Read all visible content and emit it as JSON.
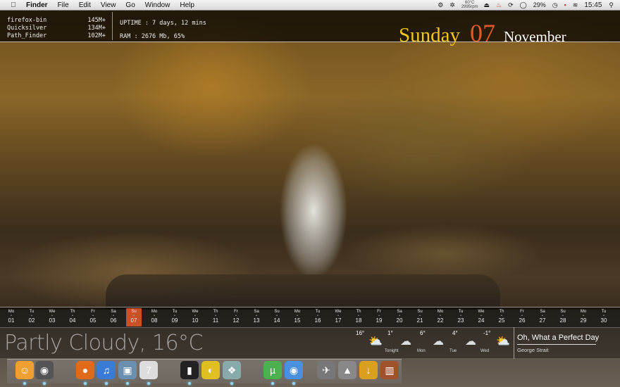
{
  "menubar": {
    "apple_icon": "apple-icon",
    "items": [
      "Finder",
      "File",
      "Edit",
      "View",
      "Go",
      "Window",
      "Help"
    ],
    "tray": {
      "temp": "60°C",
      "fan": "2995rpm",
      "battery": "29%",
      "time": "15:45"
    }
  },
  "processes": [
    {
      "name": "firefox-bin",
      "mem": "145M+"
    },
    {
      "name": "Quicksilver",
      "mem": "134M+"
    },
    {
      "name": "Path_Finder",
      "mem": "102M+"
    }
  ],
  "system": {
    "uptime": "UPTIME : 7 days, 12 mins",
    "ram": "RAM : 2676 Mb, 65%"
  },
  "date": {
    "weekday": "Sunday",
    "day": "07",
    "month": "November"
  },
  "calendar": [
    {
      "wd": "Mo",
      "dn": "01"
    },
    {
      "wd": "Tu",
      "dn": "02"
    },
    {
      "wd": "We",
      "dn": "03"
    },
    {
      "wd": "Th",
      "dn": "04"
    },
    {
      "wd": "Fr",
      "dn": "05"
    },
    {
      "wd": "Sa",
      "dn": "06"
    },
    {
      "wd": "Su",
      "dn": "07"
    },
    {
      "wd": "Mo",
      "dn": "08"
    },
    {
      "wd": "Tu",
      "dn": "09"
    },
    {
      "wd": "We",
      "dn": "10"
    },
    {
      "wd": "Th",
      "dn": "11"
    },
    {
      "wd": "Fr",
      "dn": "12"
    },
    {
      "wd": "Sa",
      "dn": "13"
    },
    {
      "wd": "Su",
      "dn": "14"
    },
    {
      "wd": "Mo",
      "dn": "15"
    },
    {
      "wd": "Tu",
      "dn": "16"
    },
    {
      "wd": "We",
      "dn": "17"
    },
    {
      "wd": "Th",
      "dn": "18"
    },
    {
      "wd": "Fr",
      "dn": "19"
    },
    {
      "wd": "Sa",
      "dn": "20"
    },
    {
      "wd": "Su",
      "dn": "21"
    },
    {
      "wd": "Mo",
      "dn": "22"
    },
    {
      "wd": "Tu",
      "dn": "23"
    },
    {
      "wd": "We",
      "dn": "24"
    },
    {
      "wd": "Th",
      "dn": "25"
    },
    {
      "wd": "Fr",
      "dn": "26"
    },
    {
      "wd": "Sa",
      "dn": "27"
    },
    {
      "wd": "Su",
      "dn": "28"
    },
    {
      "wd": "Mo",
      "dn": "29"
    },
    {
      "wd": "Tu",
      "dn": "30"
    }
  ],
  "calendar_today": "07",
  "weather": {
    "current": "Partly Cloudy, 16°C",
    "forecast": [
      {
        "temp": "16°",
        "label": "",
        "icon": "partly-cloudy-icon"
      },
      {
        "temp": "1°",
        "label": "Tonight",
        "icon": "cloud-snow-icon"
      },
      {
        "temp": "6°",
        "label": "Mon",
        "icon": "cloud-snow-icon"
      },
      {
        "temp": "4°",
        "label": "Tue",
        "icon": "cloud-snow-icon"
      },
      {
        "temp": "-1°",
        "label": "Wed",
        "icon": "partly-cloudy-icon"
      }
    ]
  },
  "music": {
    "song": "Oh, What a Perfect Day",
    "artist": "George Strait"
  },
  "dock": [
    {
      "name": "finder",
      "color": "#f0a030",
      "glyph": "☺"
    },
    {
      "name": "dashboard",
      "color": "#555",
      "glyph": "◉"
    },
    {
      "name": "firefox",
      "color": "#e06a1a",
      "glyph": "●"
    },
    {
      "name": "itunes",
      "color": "#3a7bd5",
      "glyph": "♫"
    },
    {
      "name": "preview",
      "color": "#6a8fb0",
      "glyph": "▣"
    },
    {
      "name": "ical",
      "color": "#ddd",
      "glyph": "7"
    },
    {
      "name": "terminal",
      "color": "#222",
      "glyph": "▮"
    },
    {
      "name": "color-app",
      "color": "#e0c020",
      "glyph": "◐"
    },
    {
      "name": "photos",
      "color": "#8aa",
      "glyph": "❖"
    },
    {
      "name": "utorrent",
      "color": "#4caf50",
      "glyph": "µ"
    },
    {
      "name": "chat",
      "color": "#4a90e2",
      "glyph": "◉"
    },
    {
      "name": "path-finder",
      "color": "#777",
      "glyph": "✈"
    },
    {
      "name": "stack-apps",
      "color": "#888",
      "glyph": "▲"
    },
    {
      "name": "downloads",
      "color": "#d9a020",
      "glyph": "↓"
    },
    {
      "name": "archive",
      "color": "#a0522d",
      "glyph": "▥"
    }
  ]
}
